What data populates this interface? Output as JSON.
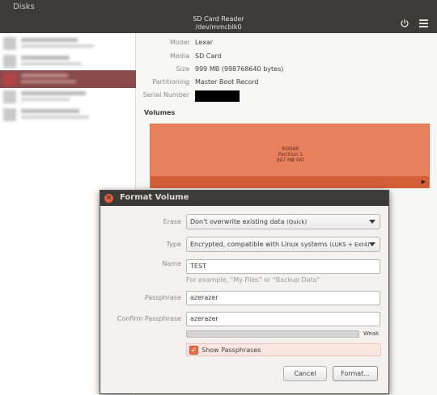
{
  "window": {
    "app_title": "Disks",
    "device_title": "SD Card Reader",
    "device_path": "/dev/mmcblk0",
    "power_icon": "power-icon",
    "menu_icon": "hamburger-menu-icon"
  },
  "drive": {
    "properties": [
      {
        "key": "Model",
        "value": "Lexar"
      },
      {
        "key": "Media",
        "value": "SD Card"
      },
      {
        "key": "Size",
        "value": "999 MB (998768640 bytes)"
      },
      {
        "key": "Partitioning",
        "value": "Master Boot Record"
      },
      {
        "key": "Serial Number",
        "value": ""
      }
    ],
    "volumes_heading": "Volumes",
    "volume": {
      "line1": "KODAK",
      "line2": "Partition 1",
      "line3": "997 MB FAT"
    }
  },
  "dialog": {
    "title": "Format Volume",
    "erase": {
      "label": "Erase",
      "value": "Don't overwrite existing data",
      "value_suffix": "(Quick)"
    },
    "type": {
      "label": "Type",
      "value": "Encrypted, compatible with Linux systems",
      "value_suffix": "(LUKS + Ext4)"
    },
    "name": {
      "label": "Name",
      "value": "TEST",
      "hint": "For example, \"My Files\" or \"Backup Data\""
    },
    "passphrase": {
      "label": "Passphrase",
      "value": "azerazer"
    },
    "confirm_passphrase": {
      "label": "Confirm Passphrase",
      "value": "azerazer"
    },
    "strength": {
      "label": "Weak",
      "level": 0.0
    },
    "show_passphrases": {
      "label": "Show Passphrases",
      "checked": true
    },
    "cancel_label": "Cancel",
    "format_label": "Format..."
  },
  "colors": {
    "titlebar": "#3c3b37",
    "accent": "#e86f47",
    "volume": "#e8805e",
    "sidebar_selected": "#8a4b4b"
  }
}
